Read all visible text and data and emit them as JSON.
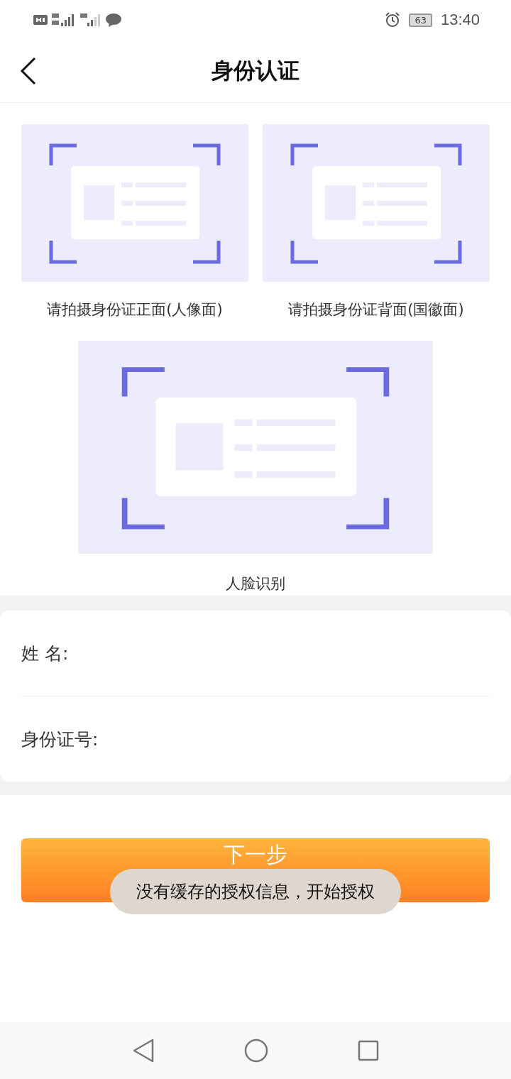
{
  "status_bar": {
    "battery": "63",
    "time": "13:40"
  },
  "header": {
    "title": "身份认证"
  },
  "captures": [
    {
      "label": "请拍摄身份证正面(人像面)"
    },
    {
      "label": "请拍摄身份证背面(国徽面)"
    },
    {
      "label": "人脸识别"
    }
  ],
  "form": {
    "fields": [
      {
        "label": "姓 名:"
      },
      {
        "label": "身份证号:"
      }
    ]
  },
  "next_button": {
    "label": "下一步"
  },
  "toast": {
    "text": "没有缓存的授权信息，开始授权"
  }
}
